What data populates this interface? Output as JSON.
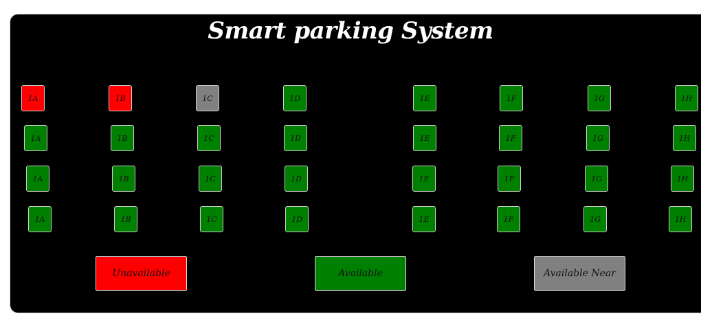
{
  "title": "Smart parking System",
  "colors": {
    "unavailable": "#ff0000",
    "available": "#008000",
    "available_near": "#808080"
  },
  "rows": [
    [
      {
        "label": "1A",
        "status": "unavailable"
      },
      {
        "label": "1B",
        "status": "unavailable"
      },
      {
        "label": "1C",
        "status": "available_near"
      },
      {
        "label": "1D",
        "status": "available"
      },
      {
        "label": "1E",
        "status": "available"
      },
      {
        "label": "1F",
        "status": "available"
      },
      {
        "label": "1G",
        "status": "available"
      },
      {
        "label": "1H",
        "status": "available"
      }
    ],
    [
      {
        "label": "1A",
        "status": "available"
      },
      {
        "label": "1B",
        "status": "available"
      },
      {
        "label": "1C",
        "status": "available"
      },
      {
        "label": "1D",
        "status": "available"
      },
      {
        "label": "1E",
        "status": "available"
      },
      {
        "label": "1F",
        "status": "available"
      },
      {
        "label": "1G",
        "status": "available"
      },
      {
        "label": "1H",
        "status": "available"
      }
    ],
    [
      {
        "label": "1A",
        "status": "available"
      },
      {
        "label": "1B",
        "status": "available"
      },
      {
        "label": "1C",
        "status": "available"
      },
      {
        "label": "1D",
        "status": "available"
      },
      {
        "label": "1E",
        "status": "available"
      },
      {
        "label": "1F",
        "status": "available"
      },
      {
        "label": "1G",
        "status": "available"
      },
      {
        "label": "1H",
        "status": "available"
      }
    ],
    [
      {
        "label": "1A",
        "status": "available"
      },
      {
        "label": "1B",
        "status": "available"
      },
      {
        "label": "1C",
        "status": "available"
      },
      {
        "label": "1D",
        "status": "available"
      },
      {
        "label": "1E",
        "status": "available"
      },
      {
        "label": "1F",
        "status": "available"
      },
      {
        "label": "1G",
        "status": "available"
      },
      {
        "label": "1H",
        "status": "available"
      }
    ]
  ],
  "legend": {
    "unavailable": "Unavailable",
    "available": "Available",
    "available_near": "Available Near"
  }
}
